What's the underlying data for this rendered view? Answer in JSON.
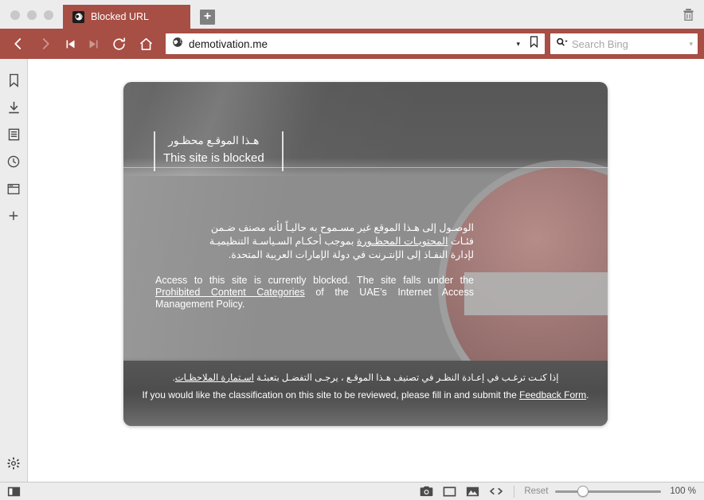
{
  "window": {
    "traffic_lights": [
      "close",
      "minimize",
      "maximize"
    ],
    "trash_icon": "trash-icon"
  },
  "tabs": [
    {
      "title": "Blocked URL",
      "favicon": "globe-icon",
      "active": true
    }
  ],
  "newtab": {
    "label": "+"
  },
  "toolbar": {
    "back": "back-icon",
    "forward": "forward-icon",
    "skip_back": "skip-back-icon",
    "skip_forward": "skip-forward-icon",
    "reload": "reload-icon",
    "home": "home-icon"
  },
  "urlbar": {
    "favicon": "globe-icon",
    "value": "demotivation.me",
    "dropdown": "▾",
    "bookmark": "bookmark-icon"
  },
  "search": {
    "icon": "search-icon",
    "placeholder": "Search Bing",
    "dropdown": "▾"
  },
  "sidebar": {
    "items": [
      {
        "name": "bookmarks",
        "icon": "bookmark-icon"
      },
      {
        "name": "downloads",
        "icon": "download-icon"
      },
      {
        "name": "reading-list",
        "icon": "reading-list-icon"
      },
      {
        "name": "history",
        "icon": "clock-icon"
      },
      {
        "name": "panels",
        "icon": "window-icon"
      },
      {
        "name": "add",
        "icon": "plus-icon"
      }
    ],
    "bottom": {
      "name": "settings",
      "icon": "gear-icon"
    }
  },
  "page": {
    "heading": {
      "arabic": "هـذا الموقـع محظـور",
      "english": "This site is blocked"
    },
    "body": {
      "arabic_line1": "الوصـول إلى هـذا الموقع غير مسـموح به حاليـاً لأنه مصنف ضـمن",
      "arabic_line2_pre": "فئـات ",
      "arabic_line2_link": "المحتويـات المحظـورة",
      "arabic_line2_post": " بموجب أحكـام السـياسـة التنظيميـة",
      "arabic_line3": "لإدارة النفـاذ إلى الإنتـرنت في دولة الإمارات العربية المتحدة.",
      "english_pre": "Access to this site is currently blocked.  The site falls under the ",
      "english_link": "Prohibited Content Categories",
      "english_post": " of the UAE’s Internet Access Management Policy."
    },
    "footer": {
      "arabic_pre": "إذا كنـت ترغـب في إعـادة النظـر في تصنيف هـذا الموقـع ، يرجـى التفضـل بتعبئـة ",
      "arabic_link": "اسـتمارة الملاحظـات",
      "arabic_post": ".",
      "english_pre": "If you would like the classification on this site to be reviewed, please fill in and submit the ",
      "english_link": "Feedback Form",
      "english_post": "."
    }
  },
  "statusbar": {
    "toggle_sidebar": "sidebar-toggle-icon",
    "icons": [
      {
        "name": "snapshot",
        "icon": "camera-icon"
      },
      {
        "name": "fit-window",
        "icon": "rectangle-icon"
      },
      {
        "name": "images",
        "icon": "image-icon"
      },
      {
        "name": "source",
        "icon": "code-icon"
      }
    ],
    "reset_label": "Reset",
    "zoom_label": "100 %"
  },
  "colors": {
    "accent": "#a74e45",
    "chrome": "#ececec",
    "page_gray": "#8e8e8e"
  }
}
